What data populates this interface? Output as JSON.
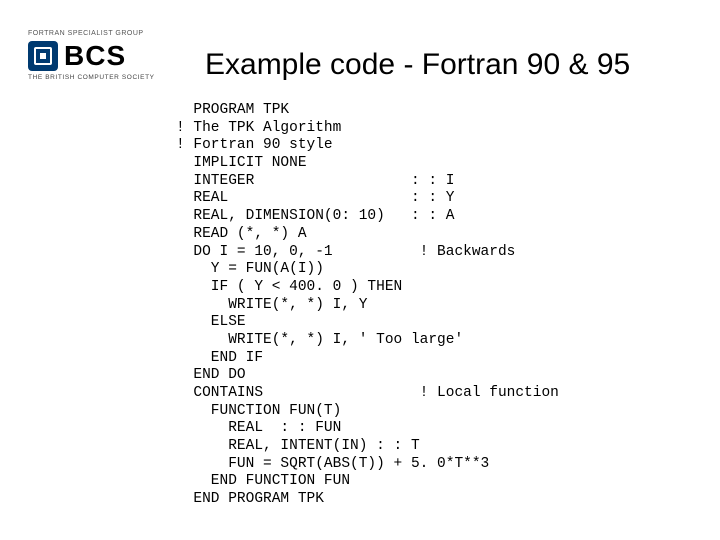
{
  "logo": {
    "top_text": "FORTRAN SPECIALIST GROUP",
    "main": "BCS",
    "sub": "THE BRITISH COMPUTER SOCIETY"
  },
  "title": "Example code - Fortran 90 & 95",
  "code": "  PROGRAM TPK\n! The TPK Algorithm\n! Fortran 90 style\n  IMPLICIT NONE\n  INTEGER                  : : I\n  REAL                     : : Y\n  REAL, DIMENSION(0: 10)   : : A\n  READ (*, *) A\n  DO I = 10, 0, -1          ! Backwards\n    Y = FUN(A(I))\n    IF ( Y < 400. 0 ) THEN\n      WRITE(*, *) I, Y\n    ELSE\n      WRITE(*, *) I, ' Too large'\n    END IF\n  END DO\n  CONTAINS                  ! Local function\n    FUNCTION FUN(T)\n      REAL  : : FUN\n      REAL, INTENT(IN) : : T\n      FUN = SQRT(ABS(T)) + 5. 0*T**3\n    END FUNCTION FUN\n  END PROGRAM TPK"
}
